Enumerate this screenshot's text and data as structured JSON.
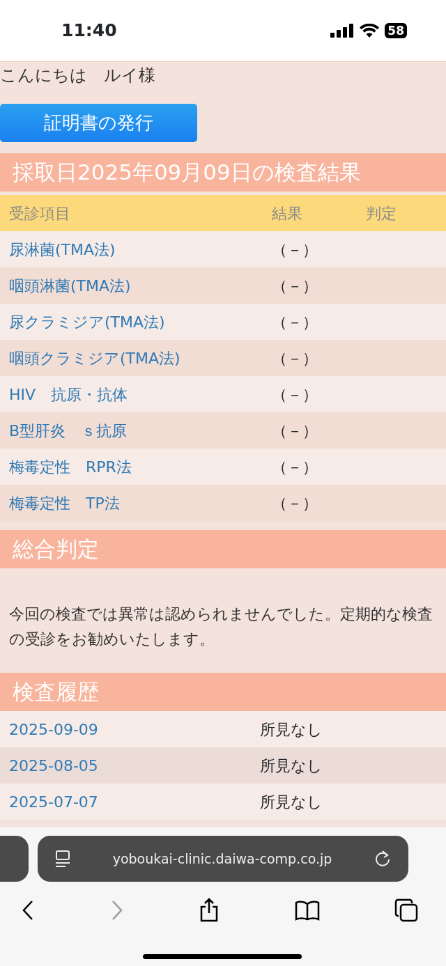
{
  "status_bar": {
    "time": "11:40",
    "battery": "58"
  },
  "greeting": {
    "text": "こんにちは",
    "name": "ルイ様"
  },
  "certificate_button": "証明書の発行",
  "results": {
    "title": "採取日2025年09月09日の検査結果",
    "columns": [
      "受診項目",
      "結果",
      "判定"
    ],
    "rows": [
      {
        "item": "尿淋菌(TMA法)",
        "result": "（－）"
      },
      {
        "item": "咽頭淋菌(TMA法)",
        "result": "（－）"
      },
      {
        "item": "尿クラミジア(TMA法)",
        "result": "（－）"
      },
      {
        "item": "咽頭クラミジア(TMA法)",
        "result": "（－）"
      },
      {
        "item": "HIV　抗原・抗体",
        "result": "（－）"
      },
      {
        "item": "B型肝炎　ｓ抗原",
        "result": "（－）"
      },
      {
        "item": "梅毒定性　RPR法",
        "result": "（－）"
      },
      {
        "item": "梅毒定性　TP法",
        "result": "（－）"
      }
    ]
  },
  "summary": {
    "title": "総合判定",
    "text": "今回の検査では異常は認められませんでした。定期的な検査の受診をお勧めいたします。"
  },
  "history": {
    "title": "検査履歴",
    "rows": [
      {
        "date": "2025-09-09",
        "finding": "所見なし"
      },
      {
        "date": "2025-08-05",
        "finding": "所見なし"
      },
      {
        "date": "2025-07-07",
        "finding": "所見なし"
      }
    ]
  },
  "browser": {
    "url": "yoboukai-clinic.daiwa-comp.co.jp",
    "back_disabled": false,
    "forward_disabled": true
  }
}
